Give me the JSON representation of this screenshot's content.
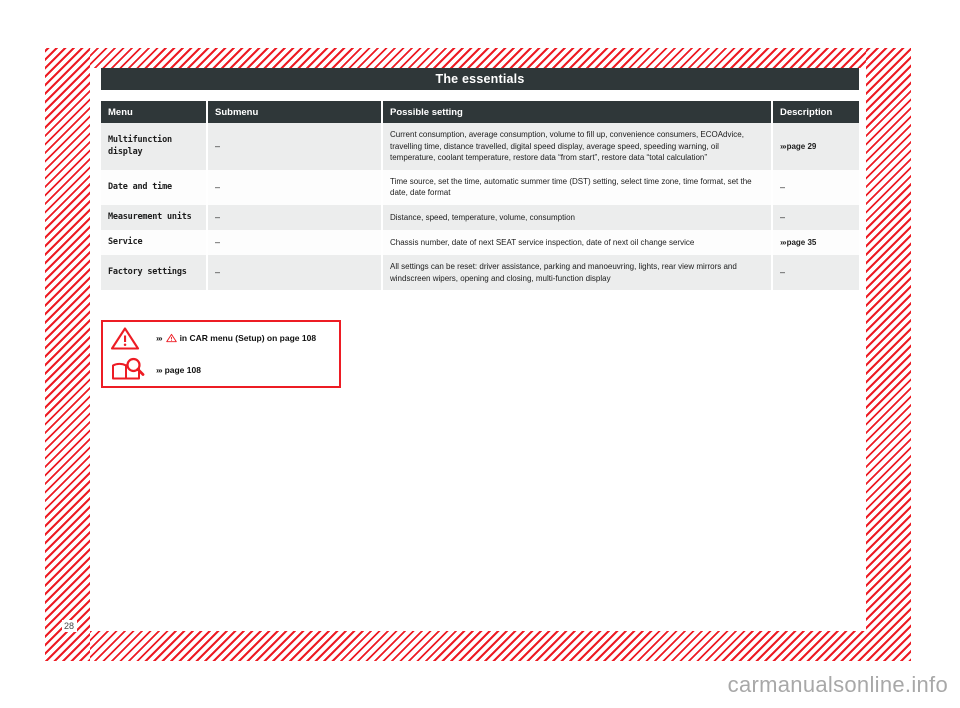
{
  "document": {
    "chapter_title": "The essentials",
    "page_number": "28",
    "watermark": "carmanualsonline.info"
  },
  "table": {
    "columns": [
      "Menu",
      "Submenu",
      "Possible setting",
      "Description"
    ],
    "rows": [
      {
        "menu": "Multifunction display",
        "submenu": "–",
        "setting": "Current consumption, average consumption, volume to fill up, convenience consumers, ECOAdvice, travelling time, distance travelled, digital speed display, average speed, speeding warning, oil temperature, coolant temperature, restore data “from start”, restore data “total calculation”",
        "description": "page 29",
        "description_has_ref": true
      },
      {
        "menu": "Date and time",
        "submenu": "–",
        "setting": "Time source, set the time, automatic summer time (DST) setting, select time zone, time format, set the date, date format",
        "description": "–",
        "description_has_ref": false
      },
      {
        "menu": "Measurement units",
        "submenu": "–",
        "setting": "Distance, speed, temperature, volume, consumption",
        "description": "–",
        "description_has_ref": false
      },
      {
        "menu": "Service",
        "submenu": "–",
        "setting": "Chassis number, date of next SEAT service inspection, date of next oil change service",
        "description": "page 35",
        "description_has_ref": true
      },
      {
        "menu": "Factory settings",
        "submenu": "–",
        "setting": "All settings can be reset: driver assistance, parking and manoeuvring, lights, rear view mirrors and windscreen wipers, opening and closing, multi-function display",
        "description": "–",
        "description_has_ref": false
      }
    ]
  },
  "reference_box": {
    "rows": [
      {
        "icon": "warning-triangle-icon",
        "text_before": "in CAR menu (Setup) on page 108",
        "has_inline_triangle": true
      },
      {
        "icon": "book-magnifier-icon",
        "text_before": "page 108",
        "has_inline_triangle": false
      }
    ]
  },
  "colors": {
    "accent_red": "#ed1c24",
    "header_dark": "#2f3739",
    "row_shaded": "#eceded"
  },
  "glyphs": {
    "chevrons": "»›"
  }
}
